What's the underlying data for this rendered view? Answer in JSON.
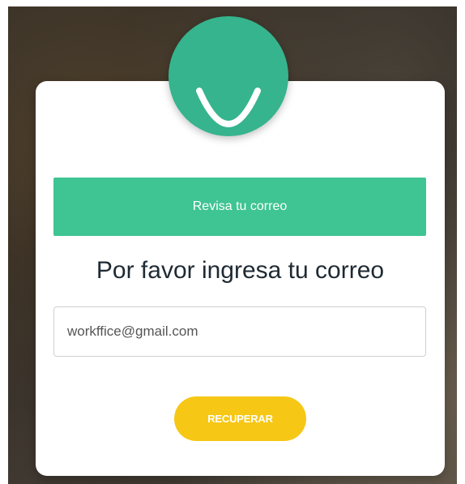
{
  "recovery": {
    "banner_text": "Revisa tu correo",
    "heading": "Por favor ingresa tu correo",
    "email_value": "workffice@gmail.com",
    "button_label": "RECUPERAR"
  },
  "colors": {
    "avatar_green": "#35b48d",
    "banner_green": "#3fc493",
    "button_yellow": "#f6c715"
  },
  "icons": {
    "avatar": "smile-icon"
  }
}
